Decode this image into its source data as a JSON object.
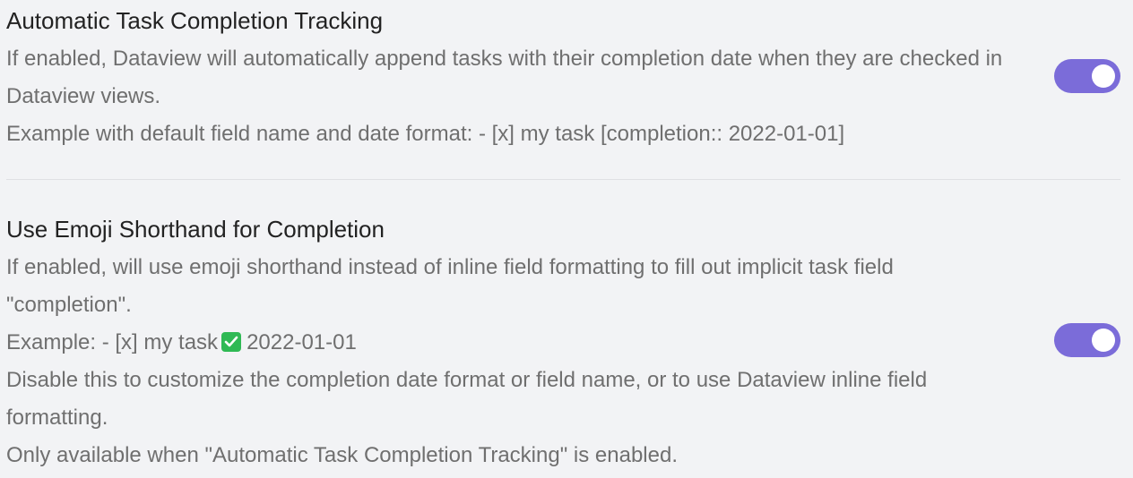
{
  "settings": [
    {
      "name": "Automatic Task Completion Tracking",
      "description": [
        "If enabled, Dataview will automatically append tasks with their completion date when they are checked in",
        "Dataview views.",
        "Example with default field name and date format: - [x] my task [completion:: 2022-01-01]"
      ],
      "enabled": true
    },
    {
      "name": "Use Emoji Shorthand for Completion",
      "description": [
        "If enabled, will use emoji shorthand instead of inline field formatting to fill out implicit task field",
        "\"completion\".",
        "Disable this to customize the completion date format or field name, or to use Dataview inline field",
        "formatting.",
        "Only available when \"Automatic Task Completion Tracking\" is enabled."
      ],
      "example_prefix": "Example: - [x] my task",
      "example_emoji_icon": "check-mark-button-emoji",
      "example_suffix": "2022-01-01",
      "enabled": true
    }
  ],
  "colors": {
    "toggle_on": "#7b6cd9",
    "emoji_check_bg": "#2fb954"
  }
}
